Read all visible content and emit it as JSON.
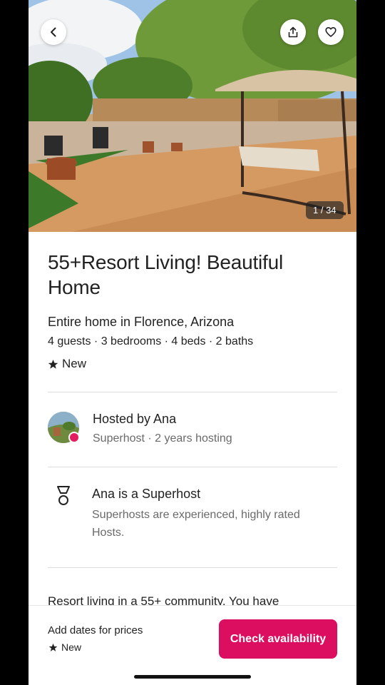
{
  "gallery": {
    "counter": "1 / 34"
  },
  "listing": {
    "title": "55+Resort Living! Beautiful Home",
    "subtitle": "Entire home in Florence, Arizona",
    "specs": "4 guests · 3 bedrooms · 4 beds · 2 baths",
    "rating_label": "New"
  },
  "host": {
    "name": "Hosted by Ana",
    "meta": "Superhost · 2 years hosting"
  },
  "superhost": {
    "title": "Ana is a Superhost",
    "description": "Superhosts are experienced, highly rated Hosts."
  },
  "description_teaser": "Resort living in a 55+ community. You have",
  "footer": {
    "price_prompt": "Add dates for prices",
    "rating_label": "New",
    "cta_label": "Check availability"
  },
  "icons": {
    "back": "chevron-left-icon",
    "share": "share-icon",
    "favorite": "heart-icon",
    "star": "star-icon",
    "superhost": "medal-icon"
  },
  "colors": {
    "accent": "#dc0e5f",
    "badge": "#e31c5f",
    "muted": "#6a6a6a"
  }
}
